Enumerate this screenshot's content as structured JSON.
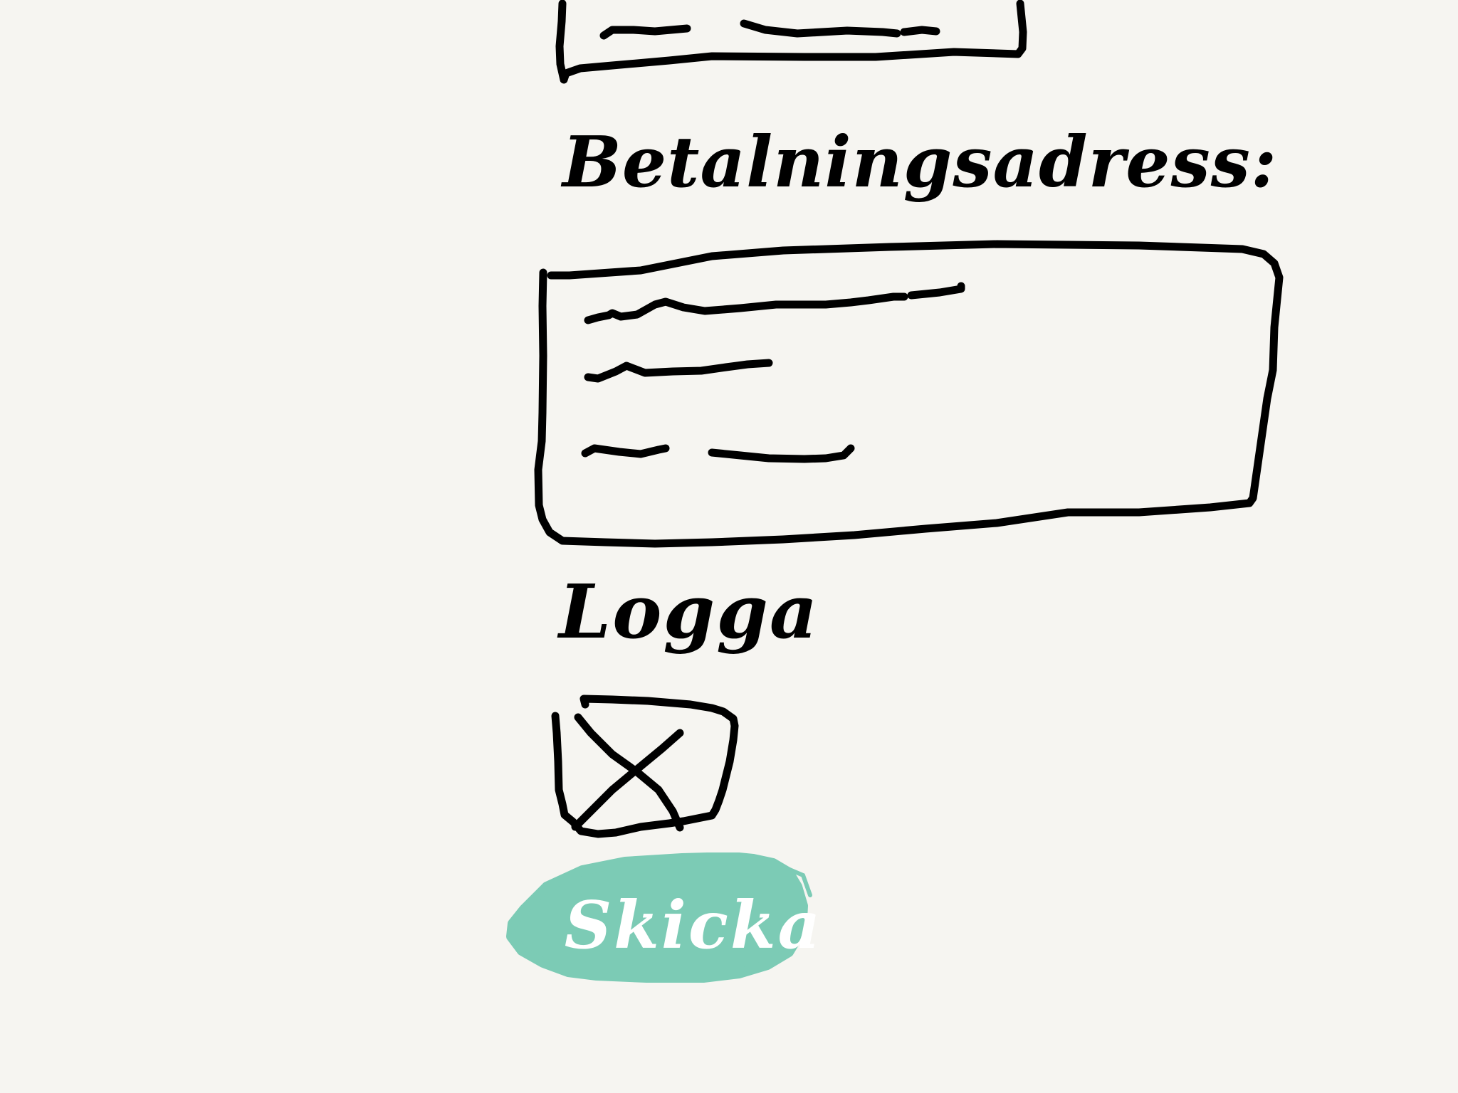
{
  "sections": {
    "billing_address": {
      "label": "Betalningsadress:"
    },
    "login": {
      "label": "Logga"
    }
  },
  "actions": {
    "submit_label": "Skicka"
  },
  "colors": {
    "background": "#f6f5f1",
    "ink": "#000000",
    "button_fill": "#7ccbb5",
    "button_text": "#ffffff"
  },
  "icons": {
    "checkbox_mark": "x-mark-icon"
  }
}
